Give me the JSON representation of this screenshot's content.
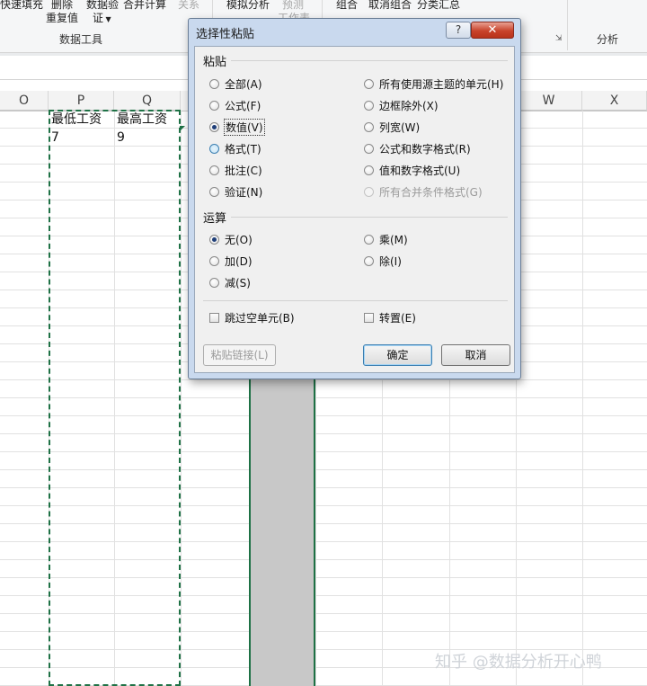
{
  "ribbon": {
    "buttons": {
      "flash_fill": "快速填充",
      "remove_dup_1": "删除",
      "remove_dup_2": "重复值",
      "validation_1": "数据验",
      "validation_2": "证",
      "consolidate": "合并计算",
      "relationships": "关系",
      "what_if": "模拟分析",
      "forecast_1": "预测",
      "forecast_2": "工作表",
      "group": "组合",
      "ungroup": "取消组合",
      "subtotal": "分类汇总"
    },
    "groups": {
      "data_tools": "数据工具",
      "analysis": "分析"
    }
  },
  "sheet": {
    "columns": [
      "O",
      "P",
      "Q",
      "W",
      "X"
    ],
    "cells": {
      "p1": "最低工资",
      "q1": "最高工资",
      "p2": "7",
      "q2": "9"
    }
  },
  "dialog": {
    "title": "选择性粘贴",
    "help": "?",
    "close": "✕",
    "paste_section": "粘贴",
    "paste_options_left": [
      {
        "label": "全部(A)",
        "state": "unchecked"
      },
      {
        "label": "公式(F)",
        "state": "unchecked"
      },
      {
        "label": "数值(V)",
        "state": "checked"
      },
      {
        "label": "格式(T)",
        "state": "hover"
      },
      {
        "label": "批注(C)",
        "state": "unchecked"
      },
      {
        "label": "验证(N)",
        "state": "unchecked"
      }
    ],
    "paste_options_right": [
      {
        "label": "所有使用源主题的单元(H)",
        "state": "unchecked"
      },
      {
        "label": "边框除外(X)",
        "state": "unchecked"
      },
      {
        "label": "列宽(W)",
        "state": "unchecked"
      },
      {
        "label": "公式和数字格式(R)",
        "state": "unchecked"
      },
      {
        "label": "值和数字格式(U)",
        "state": "unchecked"
      },
      {
        "label": "所有合并条件格式(G)",
        "state": "disabled"
      }
    ],
    "operation_section": "运算",
    "operation_left": [
      {
        "label": "无(O)",
        "state": "checked"
      },
      {
        "label": "加(D)",
        "state": "unchecked"
      },
      {
        "label": "减(S)",
        "state": "unchecked"
      }
    ],
    "operation_right": [
      {
        "label": "乘(M)",
        "state": "unchecked"
      },
      {
        "label": "除(I)",
        "state": "unchecked"
      }
    ],
    "skip_blanks": "跳过空单元(B)",
    "transpose": "转置(E)",
    "paste_link": "粘贴链接(L)",
    "ok": "确定",
    "cancel": "取消"
  },
  "watermark": "知乎 @数据分析开心鸭"
}
